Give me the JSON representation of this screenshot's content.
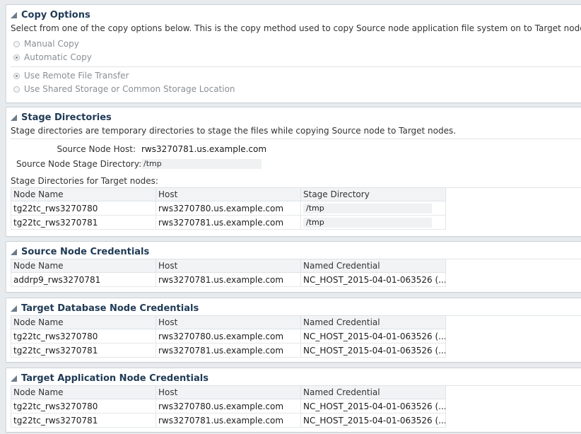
{
  "copy_options": {
    "title": "Copy Options",
    "description": "Select from one of the copy options below. This is the copy method used to copy Source node application file system on to Target nodes.",
    "copy_method": [
      {
        "label": "Manual Copy",
        "selected": false
      },
      {
        "label": "Automatic Copy",
        "selected": true
      }
    ],
    "transfer_method": [
      {
        "label": "Use Remote File Transfer",
        "selected": true
      },
      {
        "label": "Use Shared Storage or Common Storage Location",
        "selected": false
      }
    ]
  },
  "stage_directories": {
    "title": "Stage Directories",
    "description": "Stage directories are temporary directories to stage the files while copying Source node to Target nodes.",
    "source_host_label": "Source Node Host:",
    "source_host_value": "rws3270781.us.example.com",
    "source_dir_label": "Source Node Stage Directory:",
    "source_dir_value": "/tmp",
    "targets_label": "Stage Directories for Target nodes:",
    "columns": [
      "Node Name",
      "Host",
      "Stage Directory"
    ],
    "rows": [
      [
        "tg22tc_rws3270780",
        "rws3270780.us.example.com",
        "/tmp"
      ],
      [
        "tg22tc_rws3270781",
        "rws3270781.us.example.com",
        "/tmp"
      ]
    ]
  },
  "source_credentials": {
    "title": "Source Node Credentials",
    "columns": [
      "Node Name",
      "Host",
      "Named Credential"
    ],
    "rows": [
      [
        "addrp9_rws3270781",
        "rws3270781.us.example.com",
        "NC_HOST_2015-04-01-063526 (..."
      ]
    ]
  },
  "target_db_credentials": {
    "title": "Target Database Node Credentials",
    "columns": [
      "Node Name",
      "Host",
      "Named Credential"
    ],
    "rows": [
      [
        "tg22tc_rws3270780",
        "rws3270780.us.example.com",
        "NC_HOST_2015-04-01-063526 (..."
      ],
      [
        "tg22tc_rws3270781",
        "rws3270781.us.example.com",
        "NC_HOST_2015-04-01-063526 (..."
      ]
    ]
  },
  "target_app_credentials": {
    "title": "Target Application Node Credentials",
    "columns": [
      "Node Name",
      "Host",
      "Named Credential"
    ],
    "rows": [
      [
        "tg22tc_rws3270780",
        "rws3270780.us.example.com",
        "NC_HOST_2015-04-01-063526 (..."
      ],
      [
        "tg22tc_rws3270781",
        "rws3270781.us.example.com",
        "NC_HOST_2015-04-01-063526 (..."
      ]
    ]
  },
  "icons": {
    "section_toggle": "collapse-triangle-icon",
    "radio": "radio-button"
  }
}
